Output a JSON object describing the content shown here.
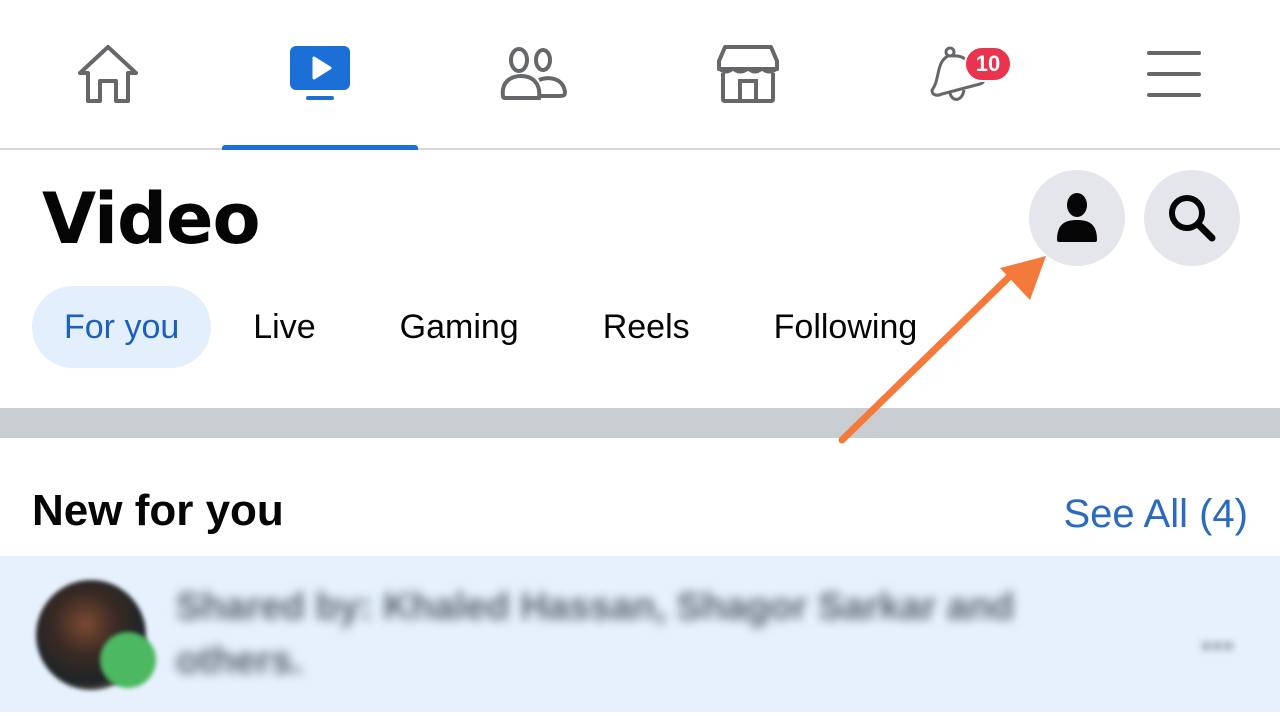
{
  "topnav": {
    "items": [
      {
        "name": "home",
        "icon": "home-icon",
        "active": false
      },
      {
        "name": "video",
        "icon": "video-tv-icon",
        "active": true
      },
      {
        "name": "friends",
        "icon": "friends-icon",
        "active": false
      },
      {
        "name": "marketplace",
        "icon": "storefront-icon",
        "active": false
      },
      {
        "name": "notifications",
        "icon": "bell-icon",
        "active": false,
        "badge": "10"
      },
      {
        "name": "menu",
        "icon": "hamburger-menu-icon",
        "active": false
      }
    ],
    "accent_color": "#1b6fd6",
    "badge_color": "#e8344e"
  },
  "header": {
    "title": "Video",
    "profile_button_icon": "person-icon",
    "search_button_icon": "search-icon"
  },
  "tabs": [
    {
      "label": "For you",
      "active": true
    },
    {
      "label": "Live",
      "active": false
    },
    {
      "label": "Gaming",
      "active": false
    },
    {
      "label": "Reels",
      "active": false
    },
    {
      "label": "Following",
      "active": false
    }
  ],
  "section": {
    "title": "New for you",
    "see_all": "See All (4)"
  },
  "notification": {
    "text": "Shared by: Khaled Hassan, Shagor Sarkar and others.",
    "more": "..."
  },
  "annotation": {
    "type": "arrow",
    "color": "#f47a3c",
    "points_to": "profile-button"
  }
}
